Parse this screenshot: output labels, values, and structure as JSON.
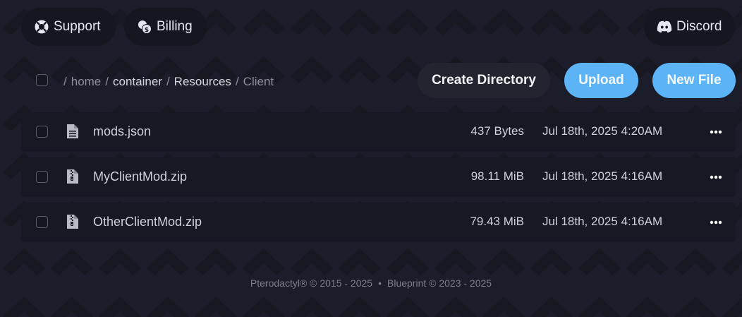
{
  "nav": {
    "support_label": "Support",
    "billing_label": "Billing",
    "discord_label": "Discord"
  },
  "breadcrumb": {
    "separator": "/",
    "segments": [
      "home",
      "container",
      "Resources",
      "Client"
    ]
  },
  "toolbar": {
    "create_directory_label": "Create Directory",
    "upload_label": "Upload",
    "new_file_label": "New File"
  },
  "files": [
    {
      "name": "mods.json",
      "size": "437 Bytes",
      "modified": "Jul 18th, 2025 4:20AM",
      "icon": "file-text-icon"
    },
    {
      "name": "MyClientMod.zip",
      "size": "98.11 MiB",
      "modified": "Jul 18th, 2025 4:16AM",
      "icon": "file-archive-icon"
    },
    {
      "name": "OtherClientMod.zip",
      "size": "79.43 MiB",
      "modified": "Jul 18th, 2025 4:16AM",
      "icon": "file-archive-icon"
    }
  ],
  "footer": {
    "pterodactyl": "Pterodactyl® © 2015 - 2025",
    "separator": "•",
    "blueprint": "Blueprint © 2023 - 2025"
  },
  "colors": {
    "background": "#1c1d2a",
    "panel": "#171823",
    "accent": "#5cb3f5"
  }
}
